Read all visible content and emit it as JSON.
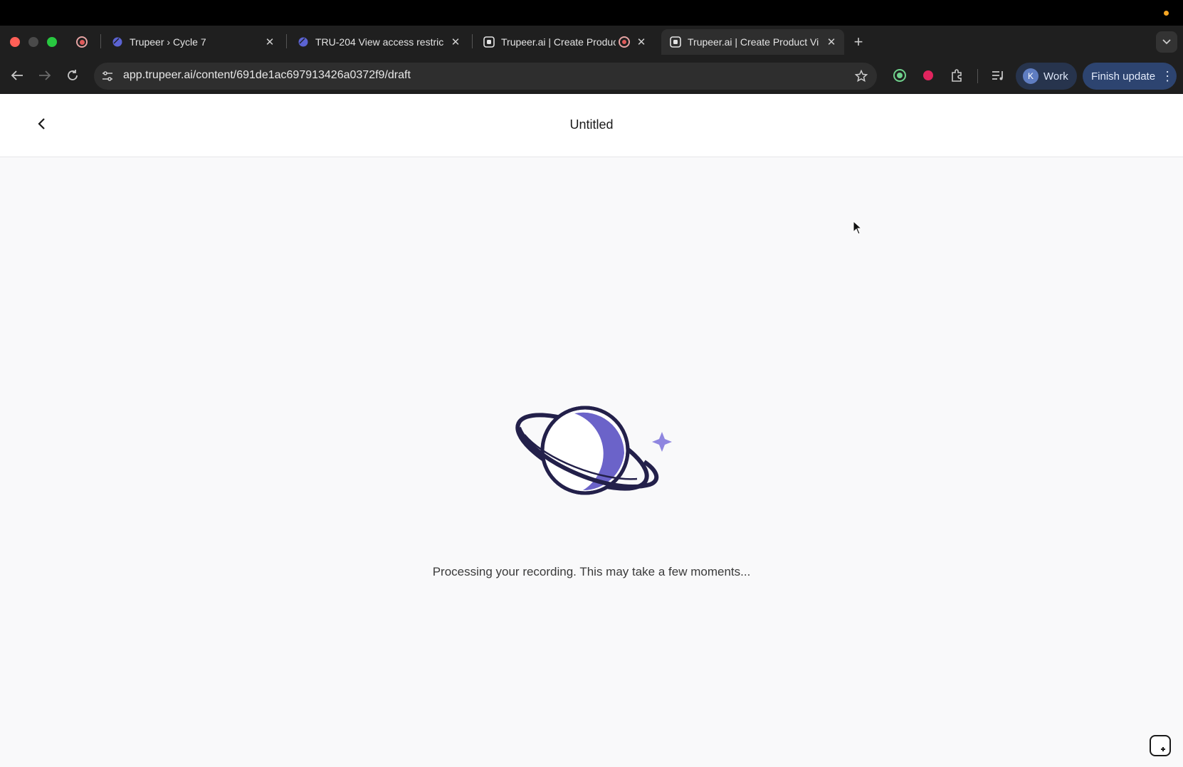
{
  "browser": {
    "tabs": [
      {
        "title": "Trupeer › Cycle 7",
        "favicon": "linear-icon",
        "active": false
      },
      {
        "title": "TRU-204 View access restric",
        "favicon": "linear-icon",
        "active": false
      },
      {
        "title": "Trupeer.ai | Create Produc",
        "favicon": "trupeer-icon",
        "active": false,
        "recording": true
      },
      {
        "title": "Trupeer.ai | Create Product Vi",
        "favicon": "trupeer-icon",
        "active": true
      }
    ],
    "url": "app.trupeer.ai/content/691de1ac697913426a0372f9/draft",
    "profile": {
      "initial": "K",
      "label": "Work"
    },
    "finish_update_label": "Finish update"
  },
  "app": {
    "title": "Untitled",
    "processing_message": "Processing your recording. This may take a few moments..."
  },
  "colors": {
    "planet": "#6b63c9",
    "planet_outline": "#23204a",
    "sparkle": "#8f86e0",
    "accent": "#2d4470"
  }
}
